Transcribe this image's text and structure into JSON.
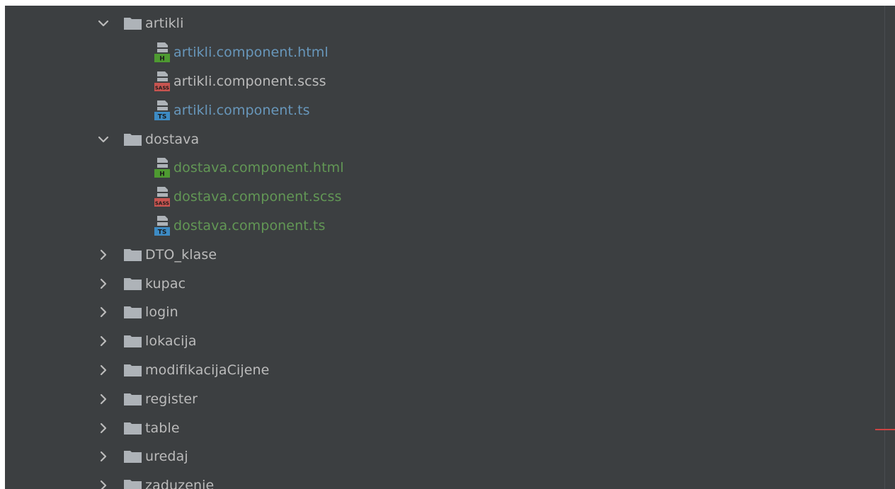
{
  "colors": {
    "background": "#3c3f41",
    "text_default": "#bbbbbb",
    "text_modified": "#6897bb",
    "text_added": "#629755",
    "folder": "#aeb3b8",
    "html_badge": "#4e9a31",
    "sass_badge": "#c75450",
    "ts_badge": "#3d8bc4",
    "error_marker": "#cc4444"
  },
  "tree": [
    {
      "type": "folder",
      "expanded": true,
      "label": "artikli",
      "icon": "folder-icon",
      "chevron": "chevron-down-icon"
    },
    {
      "type": "file",
      "label": "artikli.component.html",
      "icon": "html-file-icon",
      "badge": "H",
      "status": "modified"
    },
    {
      "type": "file",
      "label": "artikli.component.scss",
      "icon": "sass-file-icon",
      "badge": "SASS",
      "status": "default"
    },
    {
      "type": "file",
      "label": "artikli.component.ts",
      "icon": "ts-file-icon",
      "badge": "TS",
      "status": "modified"
    },
    {
      "type": "folder",
      "expanded": true,
      "label": "dostava",
      "icon": "folder-icon",
      "chevron": "chevron-down-icon"
    },
    {
      "type": "file",
      "label": "dostava.component.html",
      "icon": "html-file-icon",
      "badge": "H",
      "status": "added"
    },
    {
      "type": "file",
      "label": "dostava.component.scss",
      "icon": "sass-file-icon",
      "badge": "SASS",
      "status": "added"
    },
    {
      "type": "file",
      "label": "dostava.component.ts",
      "icon": "ts-file-icon",
      "badge": "TS",
      "status": "added"
    },
    {
      "type": "folder",
      "expanded": false,
      "label": "DTO_klase",
      "icon": "folder-icon",
      "chevron": "chevron-right-icon"
    },
    {
      "type": "folder",
      "expanded": false,
      "label": "kupac",
      "icon": "folder-icon",
      "chevron": "chevron-right-icon"
    },
    {
      "type": "folder",
      "expanded": false,
      "label": "login",
      "icon": "folder-icon",
      "chevron": "chevron-right-icon"
    },
    {
      "type": "folder",
      "expanded": false,
      "label": "lokacija",
      "icon": "folder-icon",
      "chevron": "chevron-right-icon"
    },
    {
      "type": "folder",
      "expanded": false,
      "label": "modifikacijaCijene",
      "icon": "folder-icon",
      "chevron": "chevron-right-icon"
    },
    {
      "type": "folder",
      "expanded": false,
      "label": "register",
      "icon": "folder-icon",
      "chevron": "chevron-right-icon"
    },
    {
      "type": "folder",
      "expanded": false,
      "label": "table",
      "icon": "folder-icon",
      "chevron": "chevron-right-icon"
    },
    {
      "type": "folder",
      "expanded": false,
      "label": "uredaj",
      "icon": "folder-icon",
      "chevron": "chevron-right-icon"
    },
    {
      "type": "folder",
      "expanded": false,
      "label": "zaduzenje",
      "icon": "folder-icon",
      "chevron": "chevron-right-icon"
    }
  ]
}
